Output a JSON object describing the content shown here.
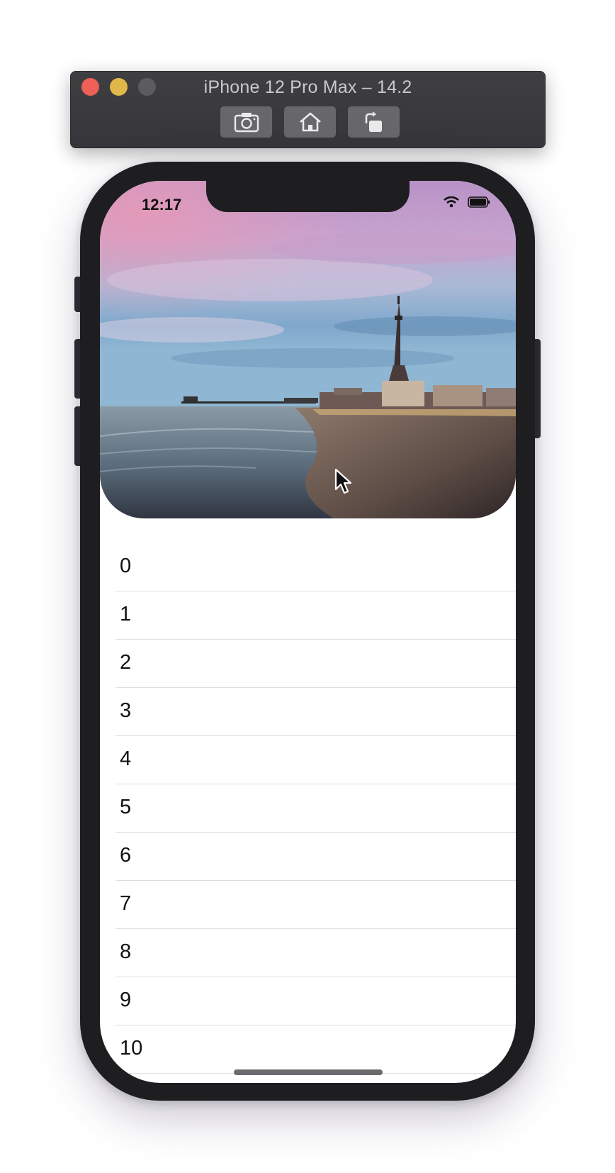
{
  "simulator": {
    "title": "iPhone 12 Pro Max – 14.2",
    "toolbar": {
      "screenshot_icon": "camera-icon",
      "home_icon": "home-icon",
      "rotate_icon": "rotate-icon"
    }
  },
  "status_bar": {
    "time": "12:17",
    "icons": [
      "wifi-icon",
      "battery-icon"
    ]
  },
  "header_image": {
    "subject": "beach-pier-tower-photo"
  },
  "list": {
    "rows": [
      "0",
      "1",
      "2",
      "3",
      "4",
      "5",
      "6",
      "7",
      "8",
      "9",
      "10"
    ]
  },
  "colors": {
    "window_close": "#ee5f58",
    "window_minimize": "#e0b84a",
    "device_body": "#1e1d20"
  }
}
